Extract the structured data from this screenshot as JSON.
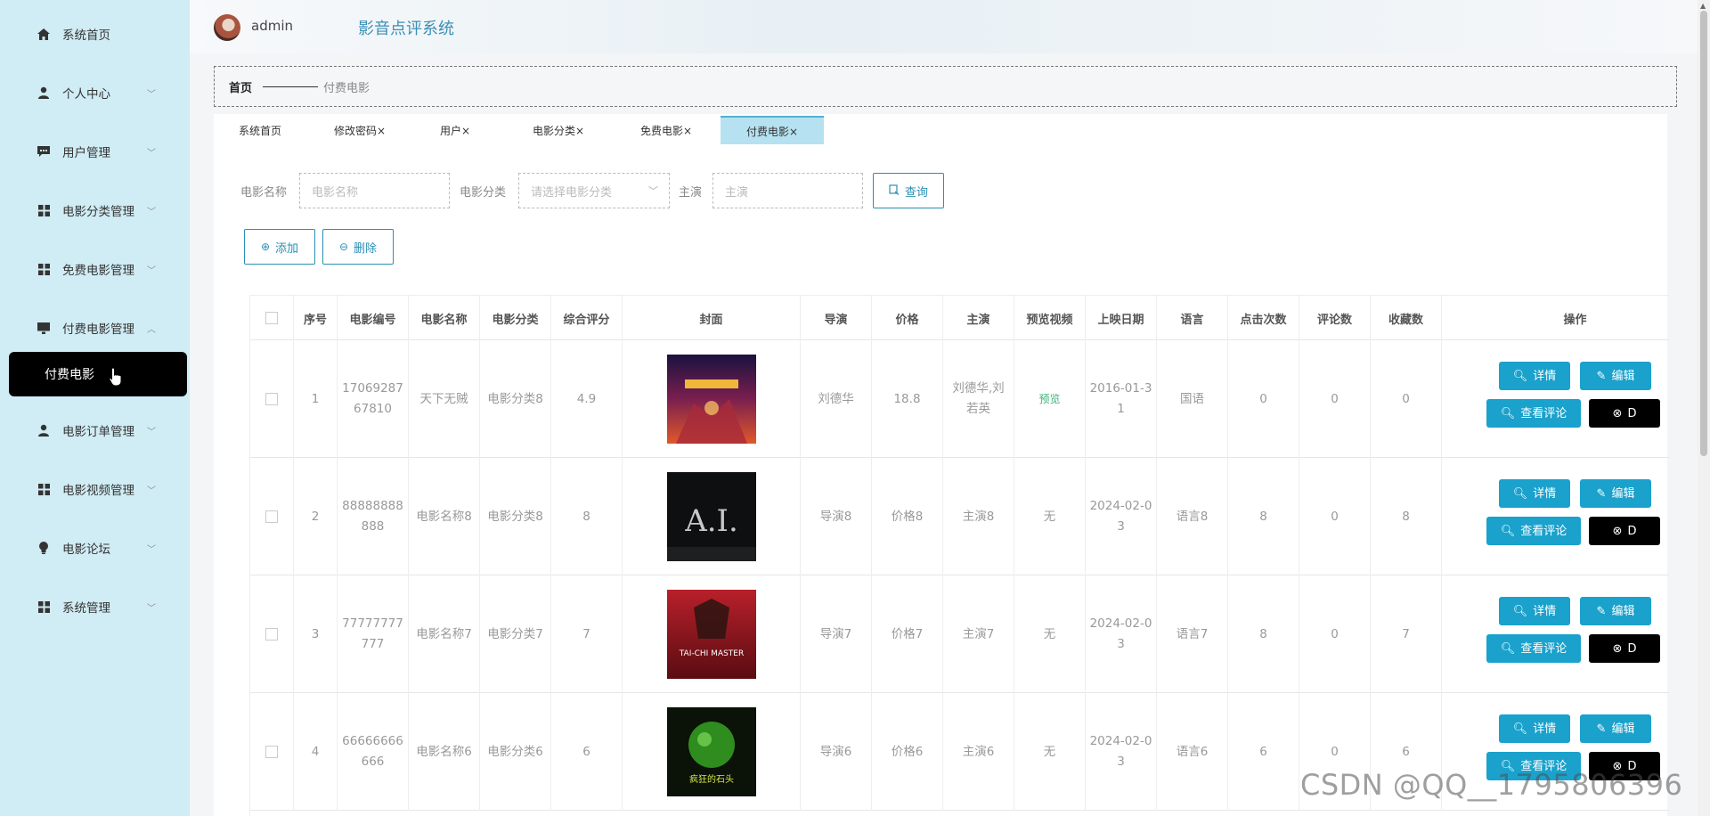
{
  "sidebar": {
    "items": [
      {
        "label": "系统首页",
        "icon": "home-icon",
        "chevron": ""
      },
      {
        "label": "个人中心",
        "icon": "user-icon",
        "chevron": "﹀"
      },
      {
        "label": "用户管理",
        "icon": "chat-icon",
        "chevron": "﹀"
      },
      {
        "label": "电影分类管理",
        "icon": "grid-icon",
        "chevron": "﹀"
      },
      {
        "label": "免费电影管理",
        "icon": "grid-icon",
        "chevron": "﹀"
      },
      {
        "label": "付费电影管理",
        "icon": "monitor-icon",
        "chevron": "︿"
      },
      {
        "label": "电影订单管理",
        "icon": "user-icon",
        "chevron": "﹀"
      },
      {
        "label": "电影视频管理",
        "icon": "grid-icon",
        "chevron": "﹀"
      },
      {
        "label": "电影论坛",
        "icon": "bulb-icon",
        "chevron": "﹀"
      },
      {
        "label": "系统管理",
        "icon": "grid-icon",
        "chevron": "﹀"
      }
    ],
    "active_sub": "付费电影"
  },
  "header": {
    "username": "admin",
    "title": "影音点评系统"
  },
  "breadcrumb": {
    "home": "首页",
    "current": "付费电影"
  },
  "tabs": [
    {
      "label": "系统首页"
    },
    {
      "label": "修改密码×"
    },
    {
      "label": "用户×"
    },
    {
      "label": "电影分类×"
    },
    {
      "label": "免费电影×"
    },
    {
      "label": "付费电影×"
    }
  ],
  "search": {
    "name_label": "电影名称",
    "name_placeholder": "电影名称",
    "category_label": "电影分类",
    "category_placeholder": "请选择电影分类",
    "actor_label": "主演",
    "actor_placeholder": "主演",
    "query_button": "查询"
  },
  "actions": {
    "add": "添加",
    "delete": "删除"
  },
  "table": {
    "headers": [
      "",
      "序号",
      "电影编号",
      "电影名称",
      "电影分类",
      "综合评分",
      "封面",
      "导演",
      "价格",
      "主演",
      "预览视频",
      "上映日期",
      "语言",
      "点击次数",
      "评论数",
      "收藏数",
      "操作"
    ],
    "rows": [
      {
        "index": "1",
        "code": "1706928767810",
        "name": "天下无贼",
        "category": "电影分类8",
        "score": "4.9",
        "director": "刘德华",
        "price": "18.8",
        "actor": "刘德华,刘若英",
        "preview": "预览",
        "date": "2016-01-31",
        "language": "国语",
        "clicks": "0",
        "comments": "0",
        "favorites": "0"
      },
      {
        "index": "2",
        "code": "88888888888",
        "name": "电影名称8",
        "category": "电影分类8",
        "score": "8",
        "director": "导演8",
        "price": "价格8",
        "actor": "主演8",
        "preview": "无",
        "date": "2024-02-03",
        "language": "语言8",
        "clicks": "8",
        "comments": "0",
        "favorites": "8"
      },
      {
        "index": "3",
        "code": "77777777777",
        "name": "电影名称7",
        "category": "电影分类7",
        "score": "7",
        "director": "导演7",
        "price": "价格7",
        "actor": "主演7",
        "preview": "无",
        "date": "2024-02-03",
        "language": "语言7",
        "clicks": "8",
        "comments": "0",
        "favorites": "7"
      },
      {
        "index": "4",
        "code": "66666666666",
        "name": "电影名称6",
        "category": "电影分类6",
        "score": "6",
        "director": "导演6",
        "price": "价格6",
        "actor": "主演6",
        "preview": "无",
        "date": "2024-02-03",
        "language": "语言6",
        "clicks": "6",
        "comments": "0",
        "favorites": "6"
      }
    ],
    "op_labels": {
      "detail": "详情",
      "edit": "编辑",
      "view_comments": "查看评论",
      "delete_short": "D"
    }
  },
  "poster_text": {
    "row2": "A.I.",
    "row3": "TAI-CHI MASTER",
    "row4": "疯狂的石头"
  },
  "watermark": "CSDN @QQ__1795806396"
}
